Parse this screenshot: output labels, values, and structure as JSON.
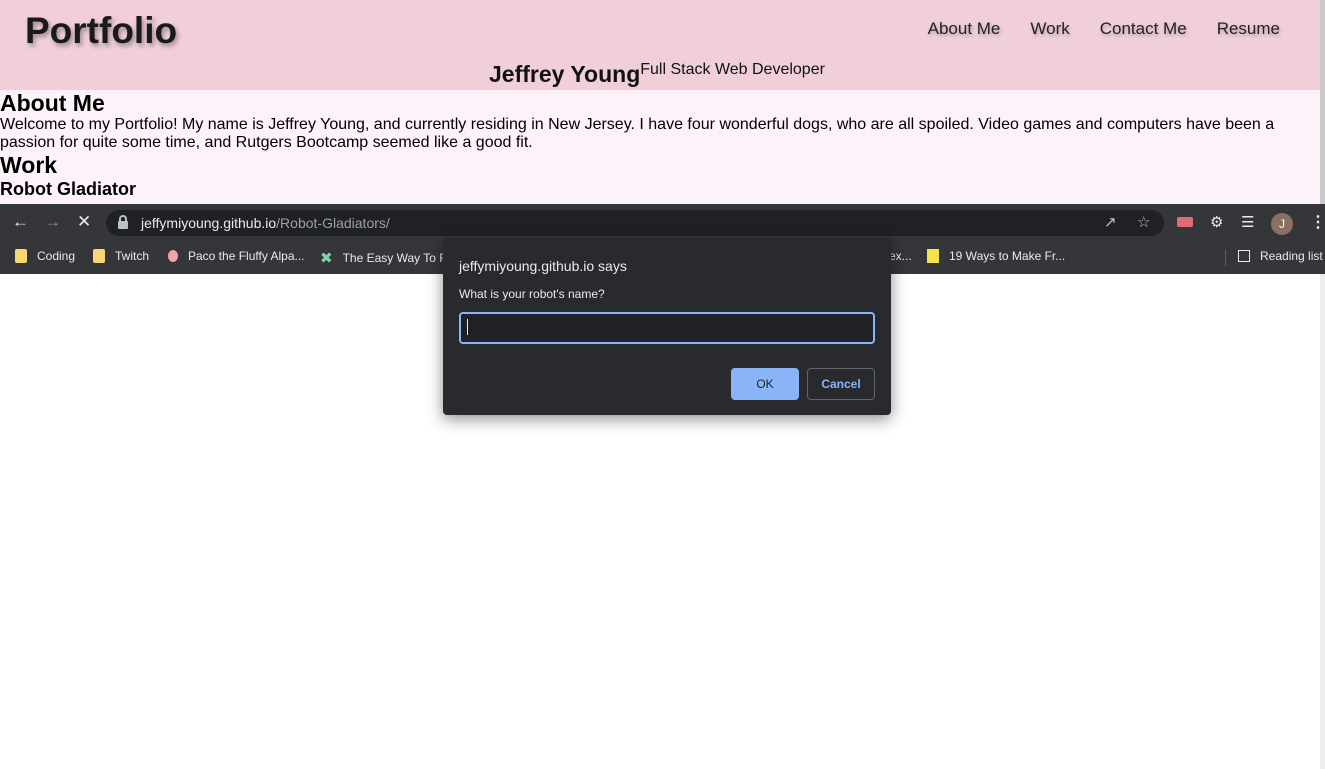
{
  "site": {
    "logo": "Portfolio",
    "nav": [
      "About Me",
      "Work",
      "Contact Me",
      "Resume"
    ],
    "name": "Jeffrey Young",
    "role": "Full Stack Web Developer",
    "about_heading": "About Me",
    "about_text": "Welcome to my Portfolio! My name is Jeffrey Young, and currently residing in New Jersey. I have four wonderful dogs, who are all spoiled. Video games and computers have been a passion for quite some time, and Rutgers Bootcamp seemed like a good fit.",
    "work_heading": "Work",
    "project_title": "Robot Gladiator"
  },
  "browser": {
    "url_host": "jeffymiyoung.github.io",
    "url_path": "/Robot-Gladiators/",
    "avatar_initial": "J",
    "bookmarks": [
      "Coding",
      "Twitch",
      "Paco the Fluffy Alpa...",
      "The Easy Way To Fi",
      "ex...",
      "19 Ways to Make Fr..."
    ],
    "reading_list": "Reading list"
  },
  "dialog": {
    "title": "jeffymiyoung.github.io says",
    "message": "What is your robot's name?",
    "input_value": "",
    "ok_label": "OK",
    "cancel_label": "Cancel"
  },
  "colors": {
    "header_bg": "#f0cfd9",
    "content_bg": "#fdf2fa",
    "chrome_bg": "#35363a",
    "dialog_bg": "#292a2d",
    "accent": "#8ab4f8"
  }
}
